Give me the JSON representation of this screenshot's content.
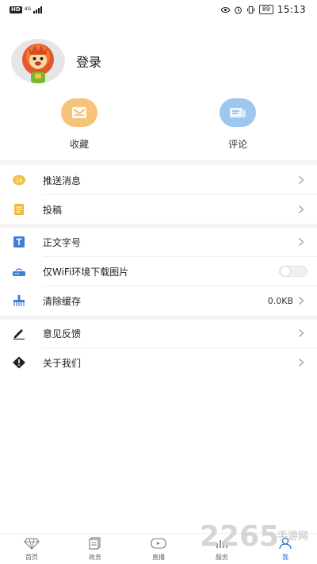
{
  "status_bar": {
    "hd": "HD",
    "net_type": "4G",
    "battery": "89",
    "time": "15:13"
  },
  "profile": {
    "login_label": "登录"
  },
  "quick_actions": [
    {
      "label": "收藏",
      "icon": "envelope-icon",
      "color": "#f5c47a"
    },
    {
      "label": "评论",
      "icon": "comment-card-icon",
      "color": "#9dc7ee"
    }
  ],
  "menu": {
    "push": {
      "label": "推送消息",
      "icon": "push-24-icon"
    },
    "submit": {
      "label": "投稿",
      "icon": "notepad-icon"
    },
    "font_size": {
      "label": "正文字号",
      "icon": "text-size-icon"
    },
    "wifi_images": {
      "label": "仅WiFi环境下载图片",
      "icon": "router-icon",
      "enabled": false
    },
    "clear_cache": {
      "label": "清除缓存",
      "value": "0.0KB",
      "icon": "broom-icon"
    },
    "feedback": {
      "label": "意见反馈",
      "icon": "pencil-icon"
    },
    "about": {
      "label": "关于我们",
      "icon": "info-diamond-icon"
    }
  },
  "bottom_nav": [
    {
      "label": "首页",
      "icon": "diamond-home-icon",
      "active": false
    },
    {
      "label": "政务",
      "icon": "document-stack-icon",
      "active": false
    },
    {
      "label": "直播",
      "icon": "live-video-icon",
      "active": false
    },
    {
      "label": "服务",
      "icon": "bar-chart-icon",
      "active": false
    },
    {
      "label": "我",
      "icon": "person-icon",
      "active": true
    }
  ],
  "watermark": {
    "text": "2265",
    "sub": "手游网"
  },
  "colors": {
    "active": "#2a6fd1",
    "favorite": "#f5c47a",
    "comment": "#9dc7ee",
    "band": "#f4f4f4"
  }
}
